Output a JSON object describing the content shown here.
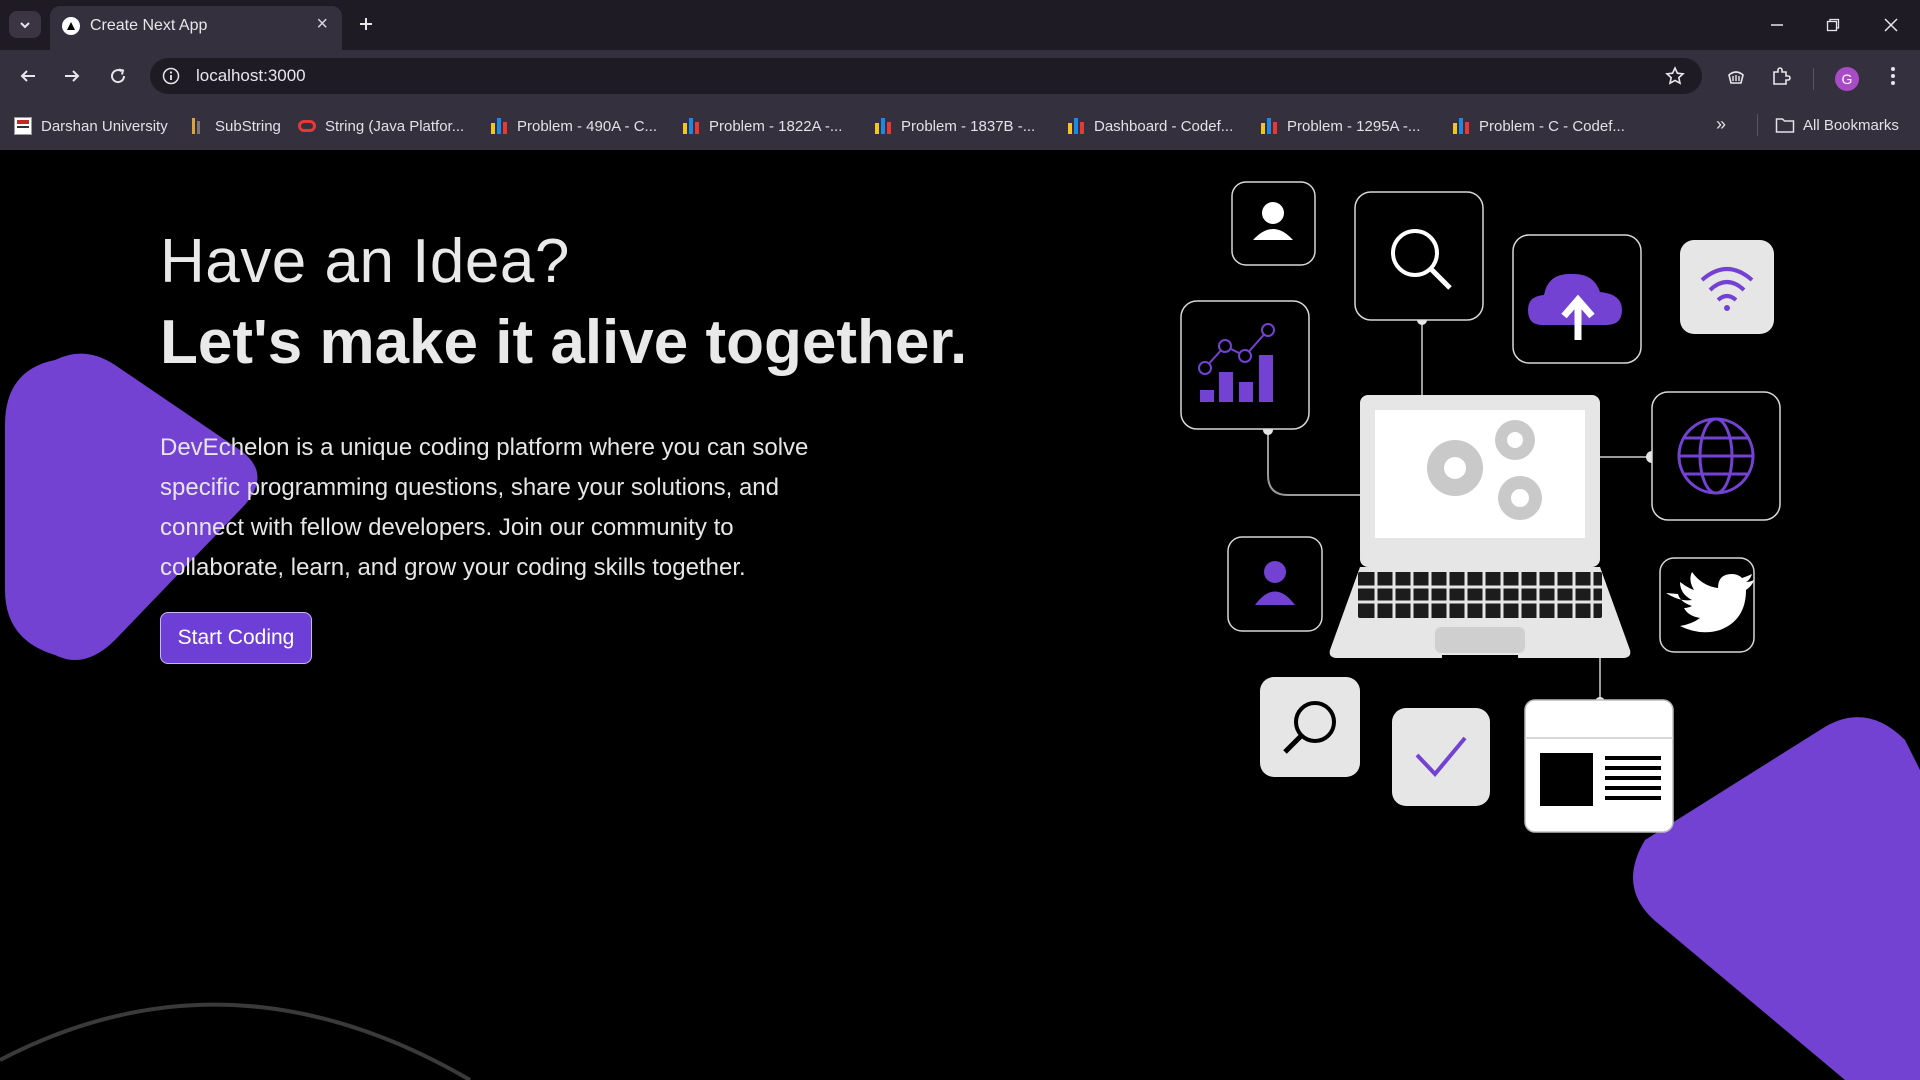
{
  "browser": {
    "tab_title": "Create Next App",
    "url": "localhost:3000",
    "avatar_letter": "G",
    "bookmarks": [
      {
        "label": "Darshan University",
        "icon": "darshan-favicon"
      },
      {
        "label": "SubString",
        "icon": "substring-favicon"
      },
      {
        "label": "String (Java Platfor...",
        "icon": "oracle-favicon"
      },
      {
        "label": "Problem - 490A - C...",
        "icon": "codeforces-favicon"
      },
      {
        "label": "Problem - 1822A -...",
        "icon": "codeforces-favicon"
      },
      {
        "label": "Problem - 1837B -...",
        "icon": "codeforces-favicon"
      },
      {
        "label": "Dashboard - Codef...",
        "icon": "codeforces-favicon"
      },
      {
        "label": "Problem - 1295A -...",
        "icon": "codeforces-favicon"
      },
      {
        "label": "Problem - C - Codef...",
        "icon": "codeforces-favicon"
      }
    ],
    "all_bookmarks_label": "All Bookmarks",
    "more_bookmarks": "»"
  },
  "hero": {
    "heading": "Have an Idea?",
    "subheading": "Let's make it alive together.",
    "description": "DevEchelon is a unique coding platform where you can solve specific programming questions, share your solutions, and connect with fellow developers. Join our community to collaborate, learn, and grow your coding skills together.",
    "cta_label": "Start Coding"
  },
  "colors": {
    "accent": "#7342d3",
    "chrome_dark": "#1f1b24",
    "chrome": "#35303d"
  }
}
